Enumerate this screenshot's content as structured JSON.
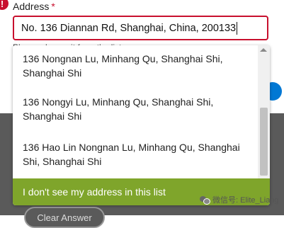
{
  "form": {
    "label": "Address",
    "required_mark": "*",
    "error_icon": "!",
    "address_value": "No. 136 Diannan Rd, Shanghai, China, 200133",
    "helper_text": "Please choose it from the list"
  },
  "dropdown": {
    "suggestions": [
      "136 Nongnan Lu, Minhang Qu, Shanghai Shi, Shanghai Shi",
      "136 Nongyi Lu, Minhang Qu, Shanghai Shi, Shanghai Shi",
      "136 Hao Lin Nongnan Lu, Minhang Qu, Shanghai Shi, Shanghai Shi"
    ],
    "no_address_option": "I don't see my address in this list",
    "highlight_color": "#7fa52b"
  },
  "footer": {
    "clear_button": "Clear Answer"
  },
  "watermark": {
    "text": "微信号: Elite_Liang"
  },
  "colors": {
    "error": "#c8102e",
    "accent_blue": "#0078d4"
  }
}
